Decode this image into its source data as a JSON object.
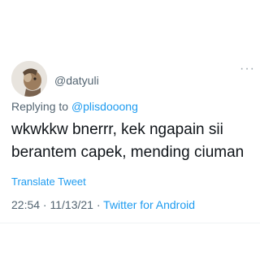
{
  "author": {
    "handle": "@datyuli"
  },
  "reply": {
    "prefix": "Replying to",
    "mention": "@plisdooong"
  },
  "tweet": {
    "text": "wkwkkw bnerrr, kek ngapain sii berantem capek, mending ciuman"
  },
  "translate_label": "Translate Tweet",
  "meta": {
    "time": "22:54",
    "separator1": " · ",
    "date": "11/13/21",
    "separator2": " · ",
    "source": "Twitter for Android"
  },
  "icons": {
    "more": "more-options-icon"
  },
  "colors": {
    "link": "#1d9bf0",
    "secondary_text": "#536471",
    "primary_text": "#0f1419"
  }
}
